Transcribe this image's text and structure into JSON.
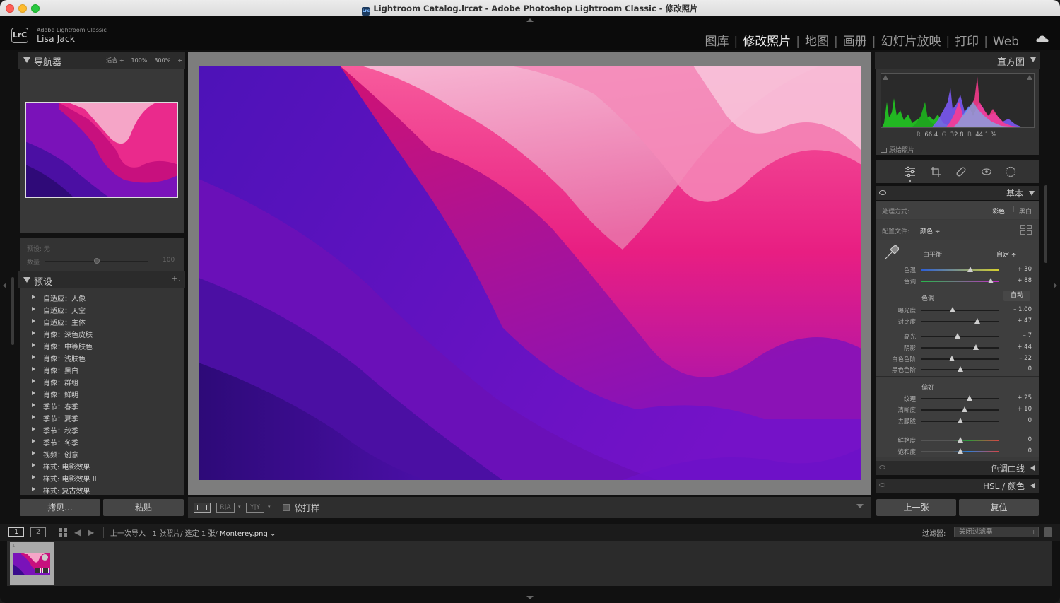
{
  "window": {
    "title": "Lightroom Catalog.lrcat - Adobe Photoshop Lightroom Classic - 修改照片",
    "title_icon": "Lrc"
  },
  "identity": {
    "logo": "LrC",
    "app_name": "Adobe Lightroom Classic",
    "user": "Lisa Jack"
  },
  "modules": [
    {
      "label": "图库",
      "active": false
    },
    {
      "label": "修改照片",
      "active": true
    },
    {
      "label": "地图",
      "active": false
    },
    {
      "label": "画册",
      "active": false
    },
    {
      "label": "幻灯片放映",
      "active": false
    },
    {
      "label": "打印",
      "active": false
    },
    {
      "label": "Web",
      "active": false
    }
  ],
  "navigator": {
    "title": "导航器",
    "zoom": {
      "fit": "适合 ÷",
      "z100": "100%",
      "z300": "300%",
      "more": "÷"
    }
  },
  "preset_amount": {
    "preset_label": "预设: 无",
    "amount_label": "数量",
    "amount_value": "100"
  },
  "presets": {
    "title": "预设",
    "add": "+.",
    "items": [
      "自适应：人像",
      "自适应：天空",
      "自适应：主体",
      "肖像：深色皮肤",
      "肖像：中等肤色",
      "肖像：浅肤色",
      "肖像：黑白",
      "肖像：群组",
      "肖像：鲜明",
      "季节：春季",
      "季节：夏季",
      "季节：秋季",
      "季节：冬季",
      "视频：创意",
      "样式: 电影效果",
      "样式: 电影效果 II",
      "样式: 复古效果"
    ]
  },
  "left_buttons": {
    "copy": "拷贝...",
    "paste": "粘贴"
  },
  "center_toolbar": {
    "ra": "R|A",
    "yy": "Y|Y",
    "soft_proof": "软打样"
  },
  "histogram": {
    "title": "直方图",
    "r_label": "R",
    "r": "66.4",
    "g_label": "G",
    "g": "32.8",
    "b_label": "B",
    "b": "44.1 %",
    "original": "原始照片"
  },
  "basic": {
    "title": "基本",
    "treatment_label": "处理方式:",
    "color": "彩色",
    "bw": "黑白",
    "profile_label": "配置文件:",
    "profile_value": "颜色 ÷",
    "wb_label": "白平衡:",
    "wb_value": "自定 ÷",
    "tone_label": "色调",
    "auto": "自动",
    "presence_label": "偏好",
    "sliders": {
      "temp": {
        "label": "色温",
        "value": "+ 30",
        "pos": 0.63
      },
      "tint": {
        "label": "色调",
        "value": "+ 88",
        "pos": 0.89
      },
      "exposure": {
        "label": "曝光度",
        "value": "– 1.00",
        "pos": 0.4
      },
      "contrast": {
        "label": "对比度",
        "value": "+ 47",
        "pos": 0.72
      },
      "highlights": {
        "label": "高光",
        "value": "– 7",
        "pos": 0.46
      },
      "shadows": {
        "label": "阴影",
        "value": "+ 44",
        "pos": 0.7
      },
      "whites": {
        "label": "白色色阶",
        "value": "– 22",
        "pos": 0.39
      },
      "blacks": {
        "label": "黑色色阶",
        "value": "0",
        "pos": 0.5
      },
      "texture": {
        "label": "纹理",
        "value": "+ 25",
        "pos": 0.62
      },
      "clarity": {
        "label": "清晰度",
        "value": "+ 10",
        "pos": 0.55
      },
      "dehaze": {
        "label": "去朦胧",
        "value": "0",
        "pos": 0.5
      },
      "vibrance": {
        "label": "鲜艳度",
        "value": "0",
        "pos": 0.5
      },
      "saturation": {
        "label": "饱和度",
        "value": "0",
        "pos": 0.5
      }
    }
  },
  "tone_curve": {
    "title": "色调曲线"
  },
  "hsl": {
    "title": "HSL / 颜色"
  },
  "right_buttons": {
    "prev": "上一张",
    "reset": "复位"
  },
  "filmstrip": {
    "page1": "1",
    "page2": "2",
    "source": "上一次导入",
    "info": "1 张照片/ 选定 1 张/",
    "file": "Monterey.png ⌄",
    "filter_label": "过滤器:",
    "filter_value": "关闭过滤器",
    "thumb_index": "1"
  },
  "colors": {
    "accent_magenta": "#e0157a",
    "accent_purple": "#5a12b8"
  }
}
